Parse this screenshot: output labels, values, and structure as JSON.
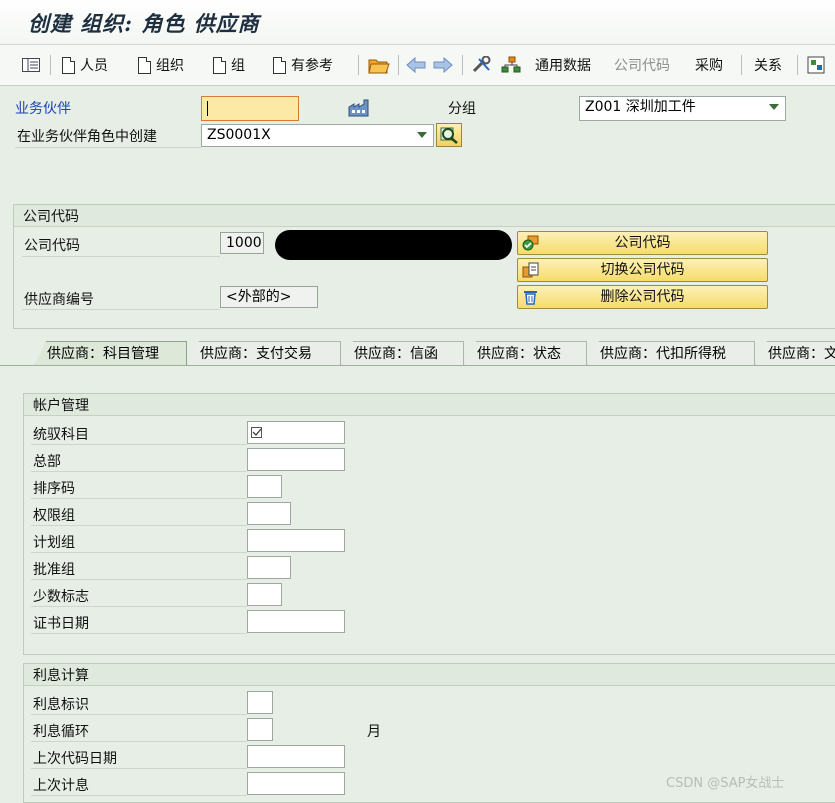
{
  "window": {
    "title": "创建 组织: 角色 供应商"
  },
  "toolbar": {
    "items": [
      {
        "label": "人员"
      },
      {
        "label": "组织"
      },
      {
        "label": "组"
      },
      {
        "label": "有参考"
      }
    ],
    "general_data": "通用数据",
    "company_code": "公司代码",
    "purchasing": "采购",
    "relations": "关系"
  },
  "header": {
    "partner_label": "业务伙伴",
    "partner_value": "",
    "group_label": "分组",
    "group_value": "Z001 深圳加工件",
    "role_label": "在业务伙伴角色中创建",
    "role_value": "ZS0001X"
  },
  "company": {
    "section_title": "公司代码",
    "code_label": "公司代码",
    "code_value": "1000",
    "vendor_no_label": "供应商编号",
    "vendor_no_value": "<外部的>",
    "btn_company_code": "公司代码",
    "btn_switch": "切换公司代码",
    "btn_delete": "删除公司代码"
  },
  "tabs": [
    {
      "label": "供应商：科目管理",
      "active": true
    },
    {
      "label": "供应商：支付交易"
    },
    {
      "label": "供应商：信函"
    },
    {
      "label": "供应商：状态"
    },
    {
      "label": "供应商：代扣所得税"
    },
    {
      "label": "供应商：文"
    }
  ],
  "account_mgmt": {
    "title": "帐户管理",
    "fields": [
      {
        "label": "统驭科目",
        "value": ""
      },
      {
        "label": "总部",
        "value": ""
      },
      {
        "label": "排序码",
        "value": ""
      },
      {
        "label": "权限组",
        "value": ""
      },
      {
        "label": "计划组",
        "value": ""
      },
      {
        "label": "批准组",
        "value": ""
      },
      {
        "label": "少数标志",
        "value": ""
      },
      {
        "label": "证书日期",
        "value": ""
      }
    ]
  },
  "interest": {
    "title": "利息计算",
    "fields": [
      {
        "label": "利息标识",
        "value": ""
      },
      {
        "label": "利息循环",
        "value": "",
        "unit": "月"
      },
      {
        "label": "上次代码日期",
        "value": ""
      },
      {
        "label": "上次计息",
        "value": ""
      }
    ]
  },
  "watermark": "CSDN @SAP女战士"
}
